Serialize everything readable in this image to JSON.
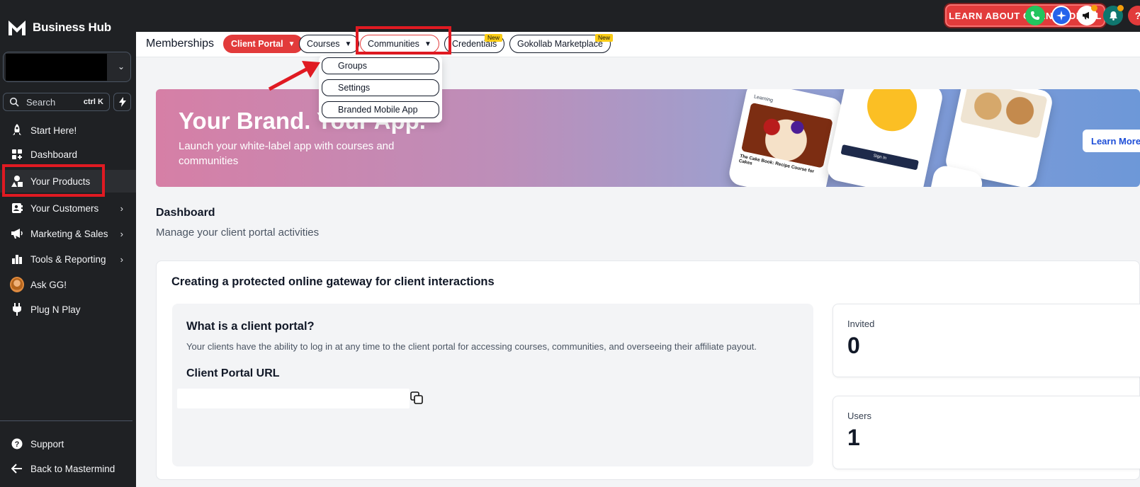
{
  "sidebar": {
    "brand": "Business Hub",
    "search_label": "Search",
    "search_shortcut": "ctrl K",
    "items": [
      {
        "label": "Start Here!"
      },
      {
        "label": "Dashboard"
      },
      {
        "label": "Your Products"
      },
      {
        "label": "Your Customers"
      },
      {
        "label": "Marketing & Sales"
      },
      {
        "label": "Tools & Reporting"
      },
      {
        "label": "Ask GG!"
      },
      {
        "label": "Plug N Play"
      }
    ],
    "footer": [
      {
        "label": "Support"
      },
      {
        "label": "Back to Mastermind"
      }
    ]
  },
  "topbar": {
    "cta": "LEARN ABOUT CLIENT PORTAL",
    "icons": [
      "phone-icon",
      "sparkle-icon",
      "megaphone-icon",
      "bell-icon",
      "help-icon"
    ]
  },
  "subnav": {
    "title": "Memberships",
    "tabs": [
      {
        "label": "Client Portal",
        "has_dropdown": true
      },
      {
        "label": "Courses",
        "has_dropdown": true
      },
      {
        "label": "Communities",
        "has_dropdown": true
      },
      {
        "label": "Credentials",
        "badge": "New"
      },
      {
        "label": "Gokollab Marketplace",
        "badge": "New"
      }
    ]
  },
  "dropdown": {
    "items": [
      "Groups",
      "Settings",
      "Branded Mobile App"
    ]
  },
  "banner": {
    "headline": "Your Brand. Your App.",
    "subtitle": "Launch your white-label app with courses and communities",
    "cta": "Learn More",
    "phone_title": "The Cake Book: Recipe Course for Cakes",
    "phone_section": "Learning",
    "phone_signin": "Sign In"
  },
  "dashboard": {
    "title": "Dashboard",
    "subtitle": "Manage your client portal activities"
  },
  "card": {
    "title": "Creating a protected online gateway for client interactions",
    "question": "What is a client portal?",
    "description": "Your clients have the ability to log in at any time to the client portal for accessing courses, communities, and overseeing their affiliate payout.",
    "url_label": "Client Portal URL",
    "url_value": ""
  },
  "stats": [
    {
      "label": "Invited",
      "value": "0"
    },
    {
      "label": "Users",
      "value": "1"
    }
  ],
  "colors": {
    "accent_red": "#e23b3b",
    "sidebar_bg": "#1f2124",
    "highlight": "#e01a22"
  }
}
